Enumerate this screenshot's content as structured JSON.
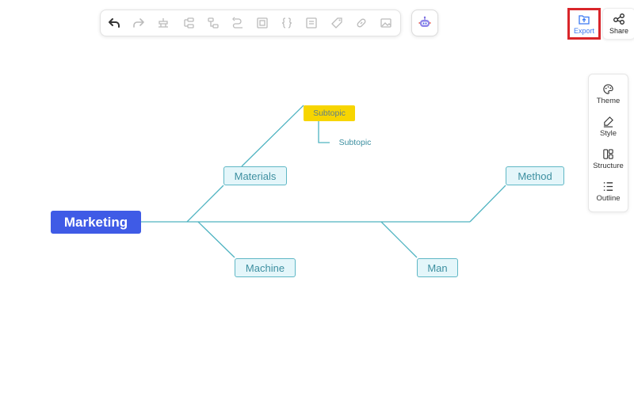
{
  "toolbar": {
    "items": [
      {
        "icon": "undo-icon"
      },
      {
        "icon": "redo-icon"
      },
      {
        "icon": "insert-topic-icon"
      },
      {
        "icon": "insert-subtopic-icon"
      },
      {
        "icon": "insert-parent-icon"
      },
      {
        "icon": "relationship-icon"
      },
      {
        "icon": "boundary-icon"
      },
      {
        "icon": "summary-icon"
      },
      {
        "icon": "note-icon"
      },
      {
        "icon": "tag-icon"
      },
      {
        "icon": "link-icon"
      },
      {
        "icon": "image-icon"
      }
    ],
    "ai_icon": "robot-icon"
  },
  "top_right": {
    "export_label": "Export",
    "share_label": "Share"
  },
  "side_panel": {
    "items": [
      {
        "label": "Theme",
        "icon": "palette-icon"
      },
      {
        "label": "Style",
        "icon": "brush-icon"
      },
      {
        "label": "Structure",
        "icon": "structure-icon"
      },
      {
        "label": "Outline",
        "icon": "outline-icon"
      }
    ]
  },
  "mindmap": {
    "root": "Marketing",
    "topics": {
      "materials": "Materials",
      "method": "Method",
      "machine": "Machine",
      "man": "Man"
    },
    "subtopic": "Subtopic",
    "sub_subtopic": "Subtopic"
  },
  "colors": {
    "root_bg": "#3f5be6",
    "topic_bg": "#e4f6fa",
    "topic_border": "#5fb7c5",
    "line": "#4fb3c1",
    "subtopic_bg": "#f7d500",
    "export_highlight": "#d9252a"
  }
}
